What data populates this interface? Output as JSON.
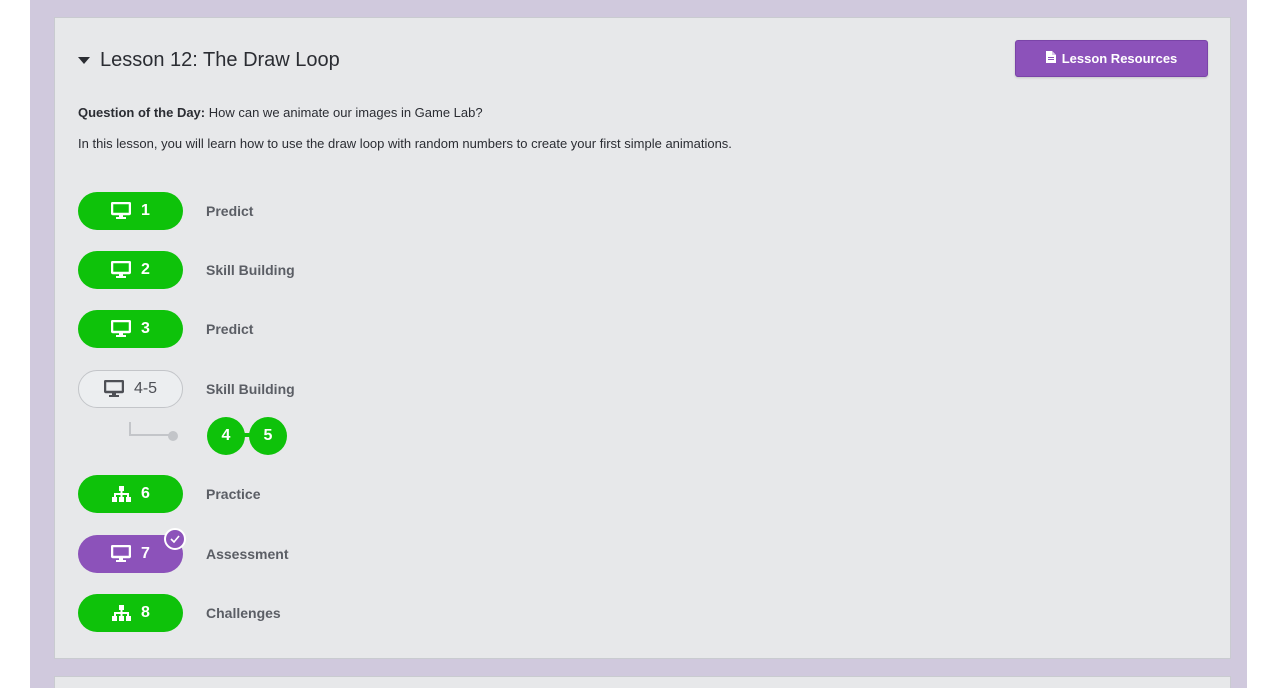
{
  "lesson": {
    "title": "Lesson 12: The Draw Loop",
    "resources_label": "Lesson Resources",
    "qotd_label": "Question of the Day:",
    "qotd_text": " How can we animate our images in Game Lab?",
    "description": "In this lesson, you will learn how to use the draw loop with random numbers to create your first simple animations."
  },
  "levels": [
    {
      "number": "1",
      "label": "Predict",
      "icon": "desktop-icon",
      "status": "completed"
    },
    {
      "number": "2",
      "label": "Skill Building",
      "icon": "desktop-icon",
      "status": "completed"
    },
    {
      "number": "3",
      "label": "Predict",
      "icon": "desktop-icon",
      "status": "completed"
    },
    {
      "number": "4-5",
      "label": "Skill Building",
      "icon": "desktop-icon",
      "status": "not-started",
      "sublevels": [
        "4",
        "5"
      ]
    },
    {
      "number": "6",
      "label": "Practice",
      "icon": "sitemap-icon",
      "status": "completed"
    },
    {
      "number": "7",
      "label": "Assessment",
      "icon": "desktop-icon",
      "status": "submitted"
    },
    {
      "number": "8",
      "label": "Challenges",
      "icon": "sitemap-icon",
      "status": "completed"
    }
  ],
  "colors": {
    "completed": "#0ec20a",
    "submitted": "#8c52ba",
    "background": "#d0c9dd"
  }
}
